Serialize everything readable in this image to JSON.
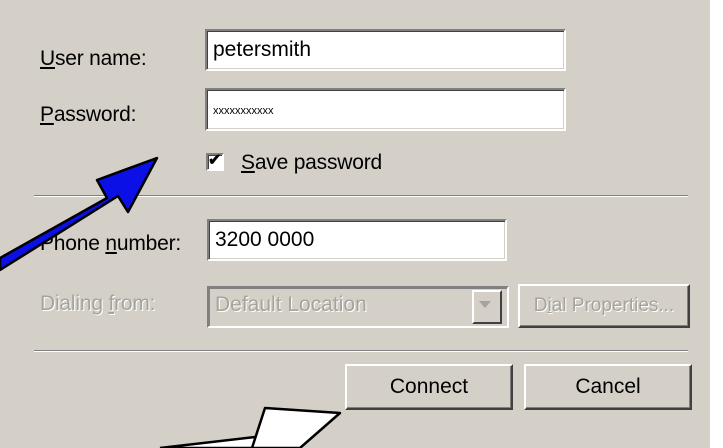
{
  "dialog": {
    "username_label": {
      "accel": "U",
      "rest": "ser name:"
    },
    "username_value": "petersmith",
    "password_label": {
      "accel": "P",
      "rest": "assword:"
    },
    "password_value": "xxxxxxxxxxx",
    "save_password": {
      "accel": "S",
      "rest": "ave password",
      "checked": true
    },
    "phone_label": {
      "before": "Phone ",
      "accel": "n",
      "rest": "umber:"
    },
    "phone_value": "3200 0000",
    "dialing_label": {
      "before": "Dialing ",
      "accel": "f",
      "rest": "rom:"
    },
    "dialing_value": "Default Location",
    "dial_properties": {
      "before": "D",
      "accel": "i",
      "rest": "al Properties..."
    },
    "connect_label": "Connect",
    "cancel_label": "Cancel"
  },
  "icons": {
    "check": "✔",
    "dropdown": "chevron-down-icon"
  },
  "colors": {
    "face": "#d4d0c8",
    "disabled_text": "#a6a39b",
    "blue_arrow": "#0a10e6",
    "white_arrow": "#ffffff"
  }
}
